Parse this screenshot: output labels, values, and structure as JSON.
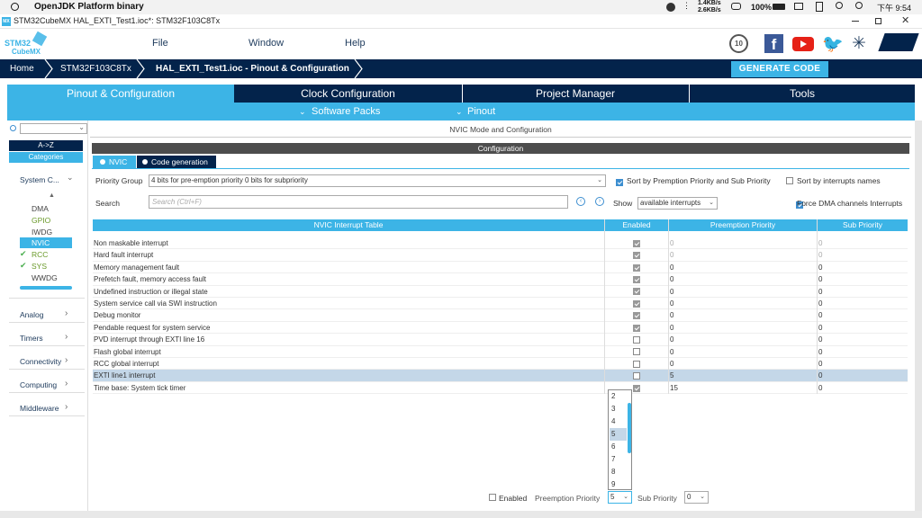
{
  "status": {
    "app": "OpenJDK Platform binary",
    "net_up": "1.4KB/s",
    "net_down": "2.6KB/s",
    "battery": "100%",
    "time": "下午 9:54"
  },
  "window": {
    "title": "STM32CubeMX HAL_EXTI_Test1.ioc*: STM32F103C8Tx",
    "app_icon": "MX"
  },
  "menu": {
    "logo_line1": "STM32",
    "logo_line2": "CubeMX",
    "file": "File",
    "window": "Window",
    "help": "Help",
    "anniv": "10"
  },
  "breadcrumb": {
    "home": "Home",
    "mcu": "STM32F103C8Tx",
    "project": "HAL_EXTI_Test1.ioc - Pinout & Configuration"
  },
  "generate_label": "GENERATE CODE",
  "tabs": [
    "Pinout & Configuration",
    "Clock Configuration",
    "Project Manager",
    "Tools"
  ],
  "subtabs": {
    "packs": "Software Packs",
    "pinout": "Pinout"
  },
  "sidebar": {
    "sort_az": "A->Z",
    "categories": "Categories",
    "system_core": "System C...",
    "items": [
      "DMA",
      "GPIO",
      "IWDG",
      "NVIC",
      "RCC",
      "SYS",
      "WWDG"
    ],
    "groups": [
      "Analog",
      "Timers",
      "Connectivity",
      "Computing",
      "Middleware"
    ]
  },
  "panel": {
    "mode_title": "NVIC Mode and Configuration",
    "config_title": "Configuration",
    "tab_nvic": "NVIC",
    "tab_codegen": "Code generation",
    "priority_group_label": "Priority Group",
    "priority_group_value": "4 bits for pre-emption priority 0 bits for subpriority",
    "sort_preempt": "Sort by Premption Priority and Sub Priority",
    "sort_names": "Sort by interrupts names",
    "search_label": "Search",
    "search_placeholder": "Search (Ctrl+F)",
    "show_label": "Show",
    "show_value": "available interrupts",
    "force_dma": "Force DMA channels Interrupts"
  },
  "table": {
    "headers": [
      "NVIC Interrupt Table",
      "Enabled",
      "Preemption Priority",
      "Sub Priority"
    ],
    "rows": [
      {
        "name": "Non maskable interrupt",
        "pre": "0",
        "sub": "0"
      },
      {
        "name": "Hard fault interrupt",
        "pre": "0",
        "sub": "0"
      },
      {
        "name": "Memory management fault",
        "pre": "0",
        "sub": "0"
      },
      {
        "name": "Prefetch fault, memory access fault",
        "pre": "0",
        "sub": "0"
      },
      {
        "name": "Undefined instruction or illegal state",
        "pre": "0",
        "sub": "0"
      },
      {
        "name": "System service call via SWI instruction",
        "pre": "0",
        "sub": "0"
      },
      {
        "name": "Debug monitor",
        "pre": "0",
        "sub": "0"
      },
      {
        "name": "Pendable request for system service",
        "pre": "0",
        "sub": "0"
      },
      {
        "name": "PVD interrupt through EXTI line 16",
        "pre": "0",
        "sub": "0"
      },
      {
        "name": "Flash global interrupt",
        "pre": "0",
        "sub": "0"
      },
      {
        "name": "RCC global interrupt",
        "pre": "0",
        "sub": "0"
      },
      {
        "name": "EXTI line1 interrupt",
        "pre": "5",
        "sub": "0"
      },
      {
        "name": "Time base: System tick timer",
        "pre": "15",
        "sub": "0"
      }
    ]
  },
  "dropdown_options": [
    "2",
    "3",
    "4",
    "5",
    "6",
    "7",
    "8",
    "9"
  ],
  "footer": {
    "enabled": "Enabled",
    "preempt_label": "Preemption Priority",
    "preempt_value": "5",
    "sub_label": "Sub Priority",
    "sub_value": "0"
  },
  "colors": {
    "navy": "#03234b",
    "accent": "#3cb4e6",
    "selected_row": "#c4d7e8"
  }
}
